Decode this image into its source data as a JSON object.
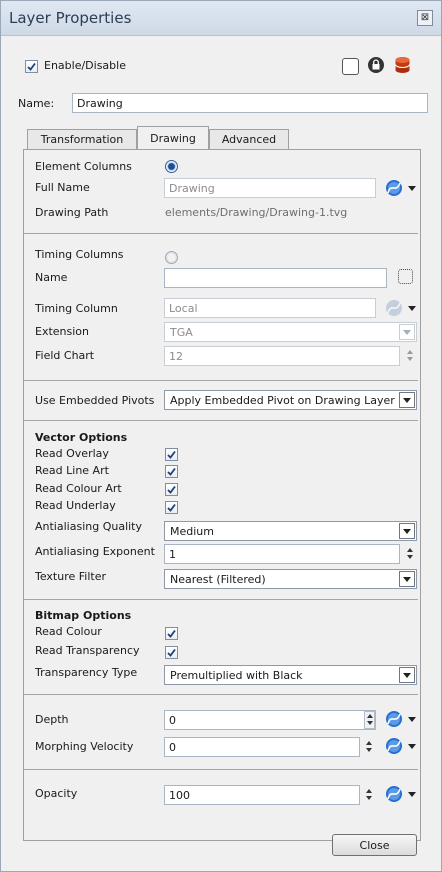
{
  "window": {
    "title": "Layer Properties",
    "close_glyph": "⊠"
  },
  "header": {
    "enable_label": "Enable/Disable",
    "name_label": "Name:",
    "name_value": "Drawing"
  },
  "tabs": [
    {
      "label": "Transformation"
    },
    {
      "label": "Drawing"
    },
    {
      "label": "Advanced"
    }
  ],
  "element": {
    "element_columns_label": "Element Columns",
    "full_name_label": "Full Name",
    "full_name_value": "Drawing",
    "drawing_path_label": "Drawing Path",
    "drawing_path_value": "elements/Drawing/Drawing-1.tvg"
  },
  "timing": {
    "timing_columns_label": "Timing Columns",
    "name_label": "Name",
    "name_value": "",
    "timing_column_label": "Timing Column",
    "timing_column_value": "Local",
    "extension_label": "Extension",
    "extension_value": "TGA",
    "field_chart_label": "Field Chart",
    "field_chart_value": "12"
  },
  "pivots": {
    "label": "Use Embedded Pivots",
    "value": "Apply Embedded Pivot on Drawing Layer"
  },
  "vector": {
    "heading": "Vector Options",
    "read_overlay_label": "Read Overlay",
    "read_line_art_label": "Read Line Art",
    "read_colour_art_label": "Read Colour Art",
    "read_underlay_label": "Read Underlay",
    "antialiasing_quality_label": "Antialiasing Quality",
    "antialiasing_quality_value": "Medium",
    "antialiasing_exponent_label": "Antialiasing Exponent",
    "antialiasing_exponent_value": "1",
    "texture_filter_label": "Texture Filter",
    "texture_filter_value": "Nearest (Filtered)"
  },
  "bitmap": {
    "heading": "Bitmap Options",
    "read_colour_label": "Read Colour",
    "read_transparency_label": "Read Transparency",
    "transparency_type_label": "Transparency Type",
    "transparency_type_value": "Premultiplied with Black"
  },
  "depth": {
    "label": "Depth",
    "value": "0"
  },
  "morphing": {
    "label": "Morphing Velocity",
    "value": "0"
  },
  "opacity": {
    "label": "Opacity",
    "value": "100"
  },
  "footer": {
    "close_label": "Close"
  },
  "colors": {
    "accent": "#1f5fae",
    "title_bar": "#d6dfeb"
  }
}
